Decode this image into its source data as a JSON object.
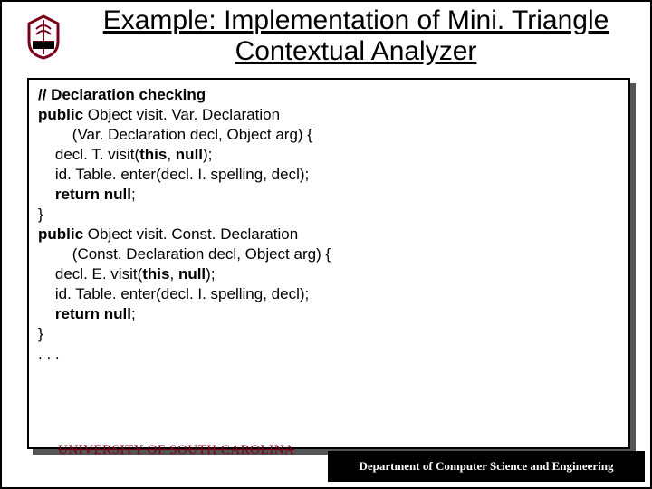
{
  "title": "Example: Implementation of Mini. Triangle Contextual Analyzer",
  "code": {
    "l01a": "// Declaration checking",
    "l02a": "public ",
    "l02b": "Object visit. Var. Declaration",
    "l03": "        (Var. Declaration decl, Object arg) {",
    "l04a": "    decl. T. visit(",
    "l04b": "this",
    "l04c": ", ",
    "l04d": "null",
    "l04e": ");",
    "l05": "    id. Table. enter(decl. I. spelling, decl);",
    "l06a": "    ",
    "l06b": "return null",
    "l06c": ";",
    "l07": "}",
    "l08": "",
    "l09a": "public ",
    "l09b": "Object visit. Const. Declaration",
    "l10": "        (Const. Declaration decl, Object arg) {",
    "l11a": "    decl. E. visit(",
    "l11b": "this",
    "l11c": ", ",
    "l11d": "null",
    "l11e": ");",
    "l12": "    id. Table. enter(decl. I. spelling, decl);",
    "l13a": "    ",
    "l13b": "return null",
    "l13c": ";",
    "l14": "}",
    "l15": ". . ."
  },
  "footer": {
    "left": "UNIVERSITY OF SOUTH CAROLINA",
    "right": "Department of Computer Science and Engineering"
  },
  "logo": {
    "main_color": "#7a0019",
    "accent_color": "#000"
  }
}
